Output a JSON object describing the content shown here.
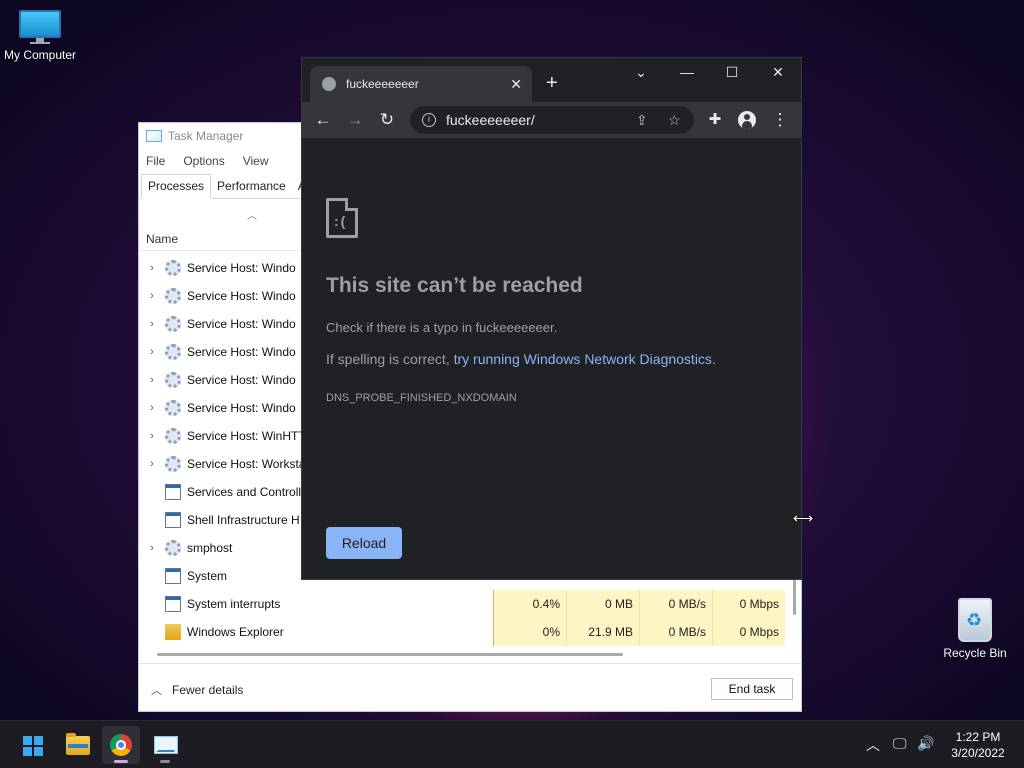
{
  "desktop": {
    "icons": [
      {
        "label": "My Computer",
        "icon": "monitor-icon"
      },
      {
        "label": "Recycle Bin",
        "icon": "recycle-bin-icon"
      }
    ]
  },
  "task_manager": {
    "title": "Task Manager",
    "menu": [
      "File",
      "Options",
      "View"
    ],
    "tabs": [
      "Processes",
      "Performance",
      "Ap"
    ],
    "active_tab": "Processes",
    "column_name": "Name",
    "rows": [
      {
        "name": "Service Host: Windo",
        "expandable": true,
        "icon": "gear-icon"
      },
      {
        "name": "Service Host: Windo",
        "expandable": true,
        "icon": "gear-icon"
      },
      {
        "name": "Service Host: Windo",
        "expandable": true,
        "icon": "gear-icon"
      },
      {
        "name": "Service Host: Windo",
        "expandable": true,
        "icon": "gear-icon"
      },
      {
        "name": "Service Host: Windo",
        "expandable": true,
        "icon": "gear-icon"
      },
      {
        "name": "Service Host: Windo",
        "expandable": true,
        "icon": "gear-icon"
      },
      {
        "name": "Service Host: WinHTT",
        "expandable": true,
        "icon": "gear-icon"
      },
      {
        "name": "Service Host: Worksta",
        "expandable": true,
        "icon": "gear-icon"
      },
      {
        "name": "Services and Controll",
        "expandable": false,
        "icon": "window-app-icon"
      },
      {
        "name": "Shell Infrastructure H",
        "expandable": false,
        "icon": "window-app-icon"
      },
      {
        "name": "smphost",
        "expandable": true,
        "icon": "gear-icon"
      },
      {
        "name": "System",
        "expandable": false,
        "icon": "window-app-icon"
      },
      {
        "name": "System interrupts",
        "expandable": false,
        "icon": "window-app-icon",
        "cpu": "0.4%",
        "memory": "0 MB",
        "disk": "0 MB/s",
        "network": "0 Mbps"
      },
      {
        "name": "Windows Explorer",
        "expandable": false,
        "icon": "folder-icon",
        "cpu": "0%",
        "memory": "21.9 MB",
        "disk": "0 MB/s",
        "network": "0 Mbps"
      }
    ],
    "fewer_details": "Fewer details",
    "end_task": "End task"
  },
  "chrome": {
    "tab_title": "fuckeeeeeeer",
    "url": "fuckeeeeeeer/",
    "error": {
      "title": "This site can’t be reached",
      "line1": "Check if there is a typo in fuckeeeeeeer.",
      "line2_prefix": "If spelling is correct, ",
      "line2_link": "try running Windows Network Diagnostics",
      "line2_suffix": ".",
      "code": "DNS_PROBE_FINISHED_NXDOMAIN"
    },
    "reload_label": "Reload",
    "accent_color": "#8ab4f8"
  },
  "taskbar": {
    "apps": [
      "start-icon",
      "file-explorer-icon",
      "chrome-icon",
      "task-manager-icon"
    ],
    "clock_time": "1:22 PM",
    "clock_date": "3/20/2022"
  }
}
